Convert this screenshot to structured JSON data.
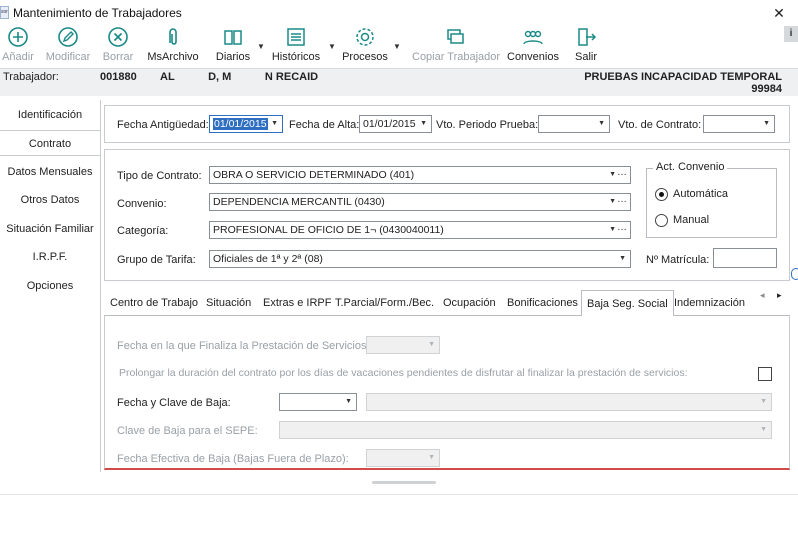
{
  "window": {
    "title": "Mantenimiento de Trabajadores",
    "app_icon_text": "sori",
    "close_glyph": "✕"
  },
  "toolbar": {
    "buttons": [
      {
        "label": "Añadir",
        "icon": "add-circle-icon",
        "enabled": false
      },
      {
        "label": "Modificar",
        "icon": "edit-pencil-icon",
        "enabled": false
      },
      {
        "label": "Borrar",
        "icon": "delete-x-icon",
        "enabled": false
      },
      {
        "label": "MsArchivo",
        "icon": "paperclip-icon",
        "enabled": true
      },
      {
        "label": "Diarios",
        "icon": "book-icon",
        "enabled": true,
        "dropdown": true
      },
      {
        "label": "Históricos",
        "icon": "list-icon",
        "enabled": true,
        "dropdown": true
      },
      {
        "label": "Procesos",
        "icon": "gear-icon",
        "enabled": true,
        "dropdown": true
      },
      {
        "label": "Copiar Trabajador",
        "icon": "copy-icon",
        "enabled": false
      },
      {
        "label": "Convenios",
        "icon": "people-icon",
        "enabled": true
      },
      {
        "label": "Salir",
        "icon": "exit-door-icon",
        "enabled": true
      }
    ],
    "info_glyph": "i"
  },
  "worker": {
    "label": "Trabajador:",
    "code": "001880",
    "name": "AL           D, M           N RECAID",
    "company": "PRUEBAS INCAPACIDAD TEMPORAL",
    "company_code": "99984"
  },
  "sidebar": {
    "items": [
      {
        "label": "Identificación",
        "active": false
      },
      {
        "label": "Contrato",
        "active": true
      },
      {
        "label": "Datos Mensuales",
        "active": false
      },
      {
        "label": "Otros Datos",
        "active": false
      },
      {
        "label": "Situación Familiar",
        "active": false
      },
      {
        "label": "I.R.P.F.",
        "active": false
      },
      {
        "label": "Opciones",
        "active": false
      }
    ]
  },
  "dates": {
    "antiguedad_label": "Fecha Antigüedad:",
    "antiguedad_value": "01/01/2015",
    "alta_label": "Fecha de Alta:",
    "alta_value": "01/01/2015",
    "vto_prueba_label": "Vto. Periodo Prueba:",
    "vto_prueba_value": "",
    "vto_contrato_label": "Vto. de Contrato:",
    "vto_contrato_value": ""
  },
  "contract": {
    "tipo_label": "Tipo de Contrato:",
    "tipo_value": "OBRA O SERVICIO DETERMINADO (401)",
    "convenio_label": "Convenio:",
    "convenio_value": "DEPENDENCIA MERCANTIL (0430)",
    "categoria_label": "Categoría:",
    "categoria_value": "PROFESIONAL DE OFICIO DE 1¬ (0430040011)",
    "grupo_label": "Grupo de Tarifa:",
    "grupo_value": "Oficiales de 1ª y 2ª (08)",
    "act_convenio_title": "Act. Convenio",
    "radio_auto": "Automática",
    "radio_manual": "Manual",
    "radio_selected": "Automática",
    "matricula_label": "Nº Matrícula:",
    "matricula_value": ""
  },
  "tabs": {
    "items": [
      {
        "label": "Centro de Trabajo",
        "active": false
      },
      {
        "label": "Situación",
        "active": false
      },
      {
        "label": "Extras e IRPF",
        "active": false
      },
      {
        "label": "T.Parcial/Form./Bec.",
        "active": false
      },
      {
        "label": "Ocupación",
        "active": false
      },
      {
        "label": "Bonificaciones",
        "active": false
      },
      {
        "label": "Baja Seg. Social",
        "active": true
      },
      {
        "label": "Indemnización",
        "active": false
      }
    ],
    "prev_glyph": "◂",
    "next_glyph": "▸"
  },
  "baja": {
    "fin_prestacion_label": "Fecha en la que Finaliza la Prestación de Servicios:",
    "prolongar_label": "Prolongar la duración del contrato por los días de vacaciones pendientes de disfrutar al finalizar la prestación de servicios:",
    "fecha_clave_label": "Fecha y Clave de Baja:",
    "clave_sepe_label": "Clave de Baja para el SEPE:",
    "fecha_efectiva_label": "Fecha Efectiva de Baja (Bajas Fuera de Plazo):"
  },
  "colors": {
    "accent": "#2f6fc1",
    "toolbar_icon": "#1a8a86",
    "disabled_text": "#9aa0a6",
    "panel_border": "#c8ccd0",
    "red_line": "#d14b4b"
  }
}
